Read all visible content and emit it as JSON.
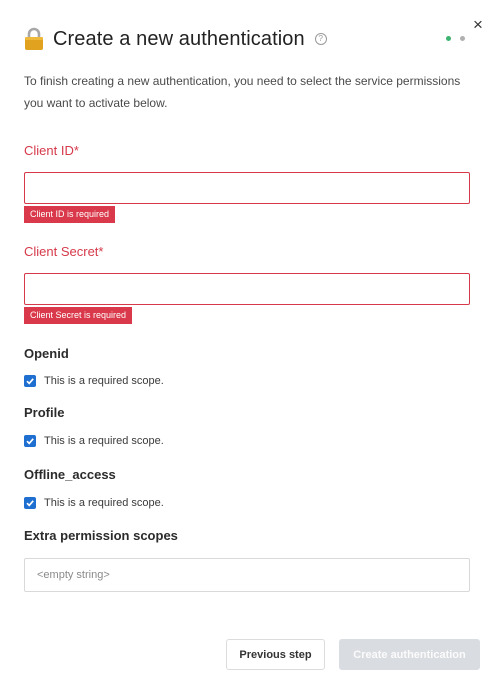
{
  "dialog": {
    "title": "Create a new authentication",
    "close_glyph": "×",
    "intro": "To finish creating a new authentication, you need to select the service permissions you want to activate below.",
    "help_glyph": "?",
    "step_dots": [
      "#3cb371",
      "#b0b0b0"
    ]
  },
  "client_id": {
    "label": "Client ID*",
    "value": "",
    "error": "Client ID is required"
  },
  "client_secret": {
    "label": "Client Secret*",
    "value": "",
    "error": "Client Secret is required"
  },
  "scopes": [
    {
      "name": "Openid",
      "checked": true,
      "note": "This is a required scope."
    },
    {
      "name": "Profile",
      "checked": true,
      "note": "This is a required scope."
    },
    {
      "name": "Offline_access",
      "checked": true,
      "note": "This is a required scope."
    }
  ],
  "extra_scopes": {
    "label": "Extra permission scopes",
    "value": "<empty string>"
  },
  "buttons": {
    "previous": "Previous step",
    "create": "Create authentication"
  },
  "colors": {
    "error": "#d6394a",
    "checkbox": "#1f6fd1",
    "disabled_button": "#d9dce1"
  },
  "icons": {
    "header": "lock-icon",
    "help": "help-circle-icon",
    "close": "close-icon",
    "check": "checkmark-icon"
  }
}
